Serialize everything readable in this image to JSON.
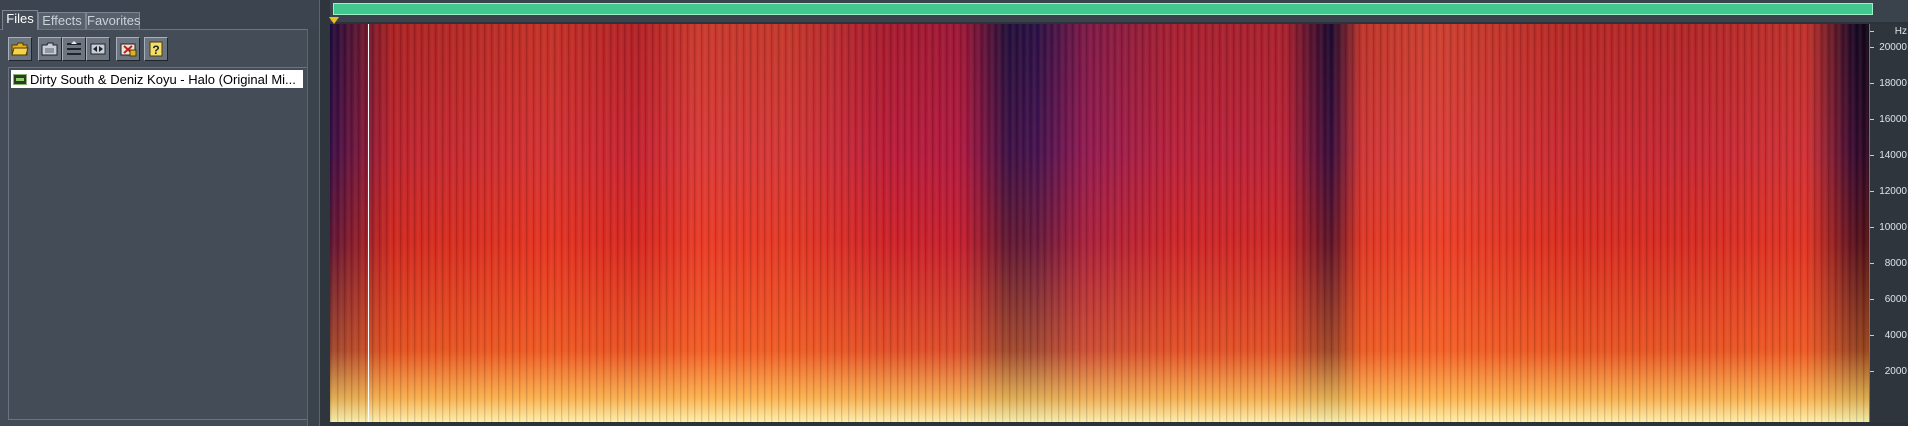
{
  "tabs": [
    {
      "label": "Files",
      "active": true
    },
    {
      "label": "Effects",
      "active": false
    },
    {
      "label": "Favorites",
      "active": false
    }
  ],
  "toolbar": {
    "buttons": [
      {
        "name": "open-file-button",
        "icon": "folder-open-icon"
      },
      {
        "name": "import-folder-button",
        "icon": "folder-icon"
      },
      {
        "name": "sort-list-button",
        "icon": "list-icon"
      },
      {
        "name": "fit-view-button",
        "icon": "arrows-icon"
      },
      {
        "name": "close-file-button",
        "icon": "close-file-icon"
      },
      {
        "name": "help-button",
        "icon": "question-icon"
      }
    ]
  },
  "files": [
    {
      "name": "Dirty South & Deniz Koyu - Halo (Original Mi..."
    }
  ],
  "spectral_view": {
    "axis_unit": "Hz",
    "axis_ticks": [
      "20000",
      "18000",
      "16000",
      "14000",
      "12000",
      "10000",
      "8000",
      "6000",
      "4000",
      "2000"
    ],
    "colors": {
      "overview_bar": "#42c88e",
      "playhead": "#e9c020",
      "cursor": "#ffffff"
    }
  }
}
